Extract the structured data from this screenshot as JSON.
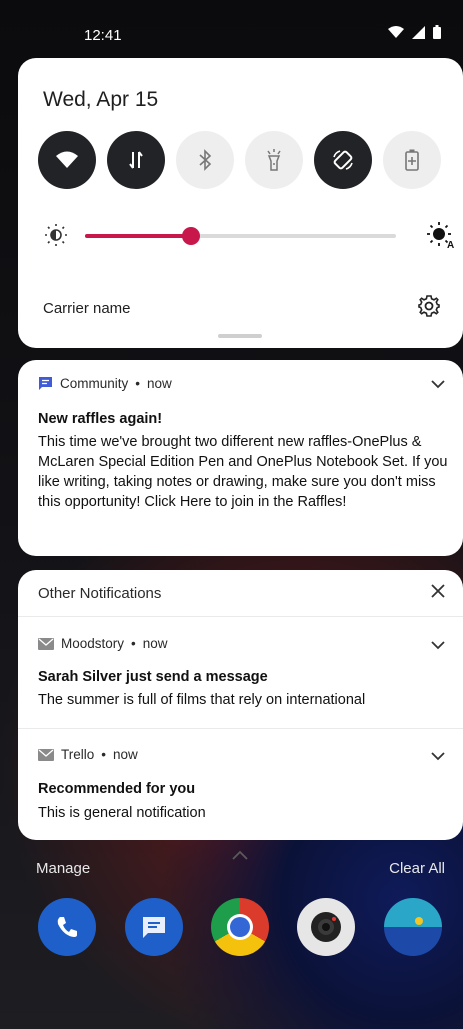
{
  "status_bar": {
    "time": "12:41",
    "icons": [
      "wifi-icon",
      "cell-signal-icon",
      "battery-icon"
    ]
  },
  "quick_settings": {
    "date": "Wed, Apr 15",
    "tiles": [
      {
        "icon": "wifi-icon",
        "active": true
      },
      {
        "icon": "mobile-data-icon",
        "active": true
      },
      {
        "icon": "bluetooth-icon",
        "active": false
      },
      {
        "icon": "flashlight-icon",
        "active": false
      },
      {
        "icon": "auto-rotate-icon",
        "active": true
      },
      {
        "icon": "battery-saver-icon",
        "active": false
      }
    ],
    "brightness": 0.34,
    "carrier_name": "Carrier name",
    "accent_color": "#c8174b"
  },
  "notification_community": {
    "app": "Community",
    "time": "now",
    "title": "New raffles again!",
    "body": "This time we've brought two different new raffles-OnePlus & McLaren Special Edition Pen and OnePlus Notebook Set. If you like writing, taking notes or drawing, make sure you don't miss this opportunity! Click Here to join in the Raffles!"
  },
  "other_notifications": {
    "header": "Other Notifications",
    "items": [
      {
        "app": "Moodstory",
        "time": "now",
        "title": "Sarah Silver just send a message",
        "body": "The summer is full of films that rely on international"
      },
      {
        "app": "Trello",
        "time": "now",
        "title": "Recommended for you",
        "body": "This is general notification"
      }
    ]
  },
  "bottom": {
    "manage": "Manage",
    "clear_all": "Clear All"
  },
  "dock": [
    "phone-icon",
    "messages-icon",
    "chrome-icon",
    "camera-icon",
    "gallery-icon"
  ]
}
